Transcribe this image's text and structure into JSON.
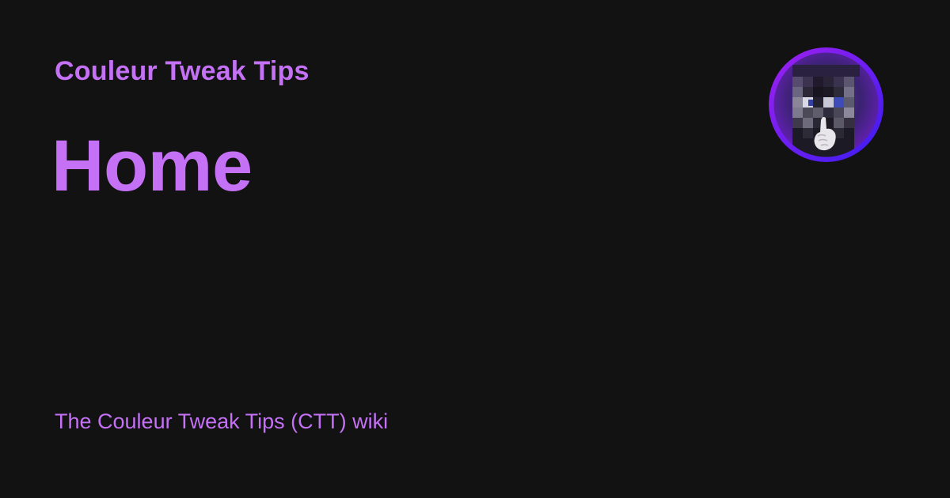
{
  "header": {
    "site_name": "Couleur Tweak Tips"
  },
  "page": {
    "title": "Home",
    "description": "The Couleur Tweak Tips (CTT) wiki"
  },
  "logo": {
    "icon": "pixelated-hooded-figure-shush-icon"
  },
  "colors": {
    "background": "#121213",
    "accent": "#c471f5",
    "logo_ring_start": "#a020f0",
    "logo_ring_end": "#3a1cf0"
  }
}
